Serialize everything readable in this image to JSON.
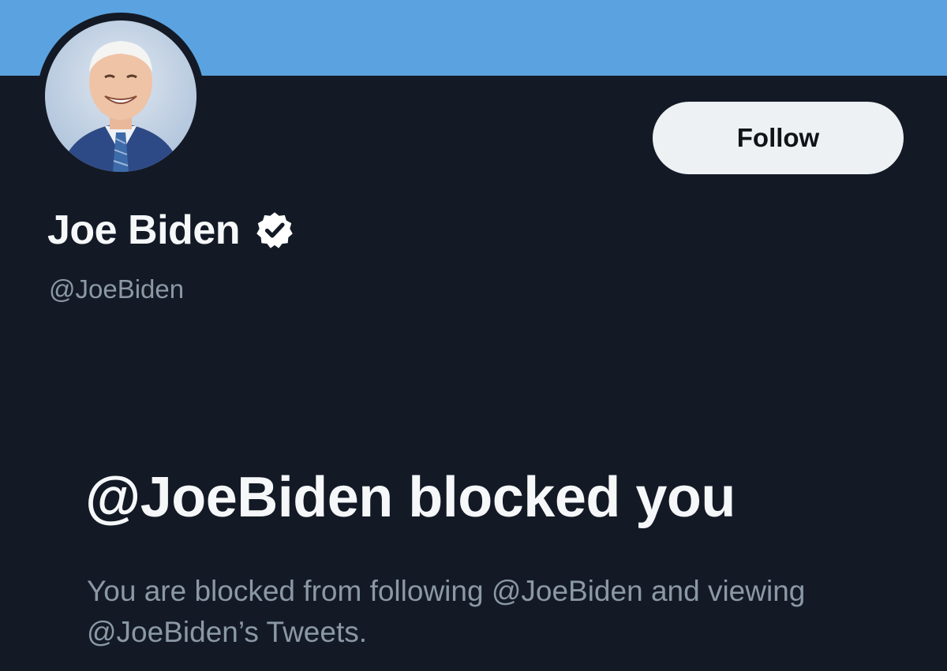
{
  "profile": {
    "display_name": "Joe Biden",
    "handle": "@JoeBiden",
    "verified": true,
    "verified_icon": "verified-badge-icon",
    "avatar": "profile-photo"
  },
  "actions": {
    "follow_label": "Follow"
  },
  "blocked_notice": {
    "title": "@JoeBiden blocked you",
    "message": "You are blocked from following @JoeBiden and viewing @JoeBiden’s Tweets."
  },
  "colors": {
    "banner": "#5ba3e0",
    "background": "#131a26",
    "primary_text": "#f5f7f9",
    "secondary_text": "#8b98a5",
    "button_bg": "#eef1f4"
  }
}
